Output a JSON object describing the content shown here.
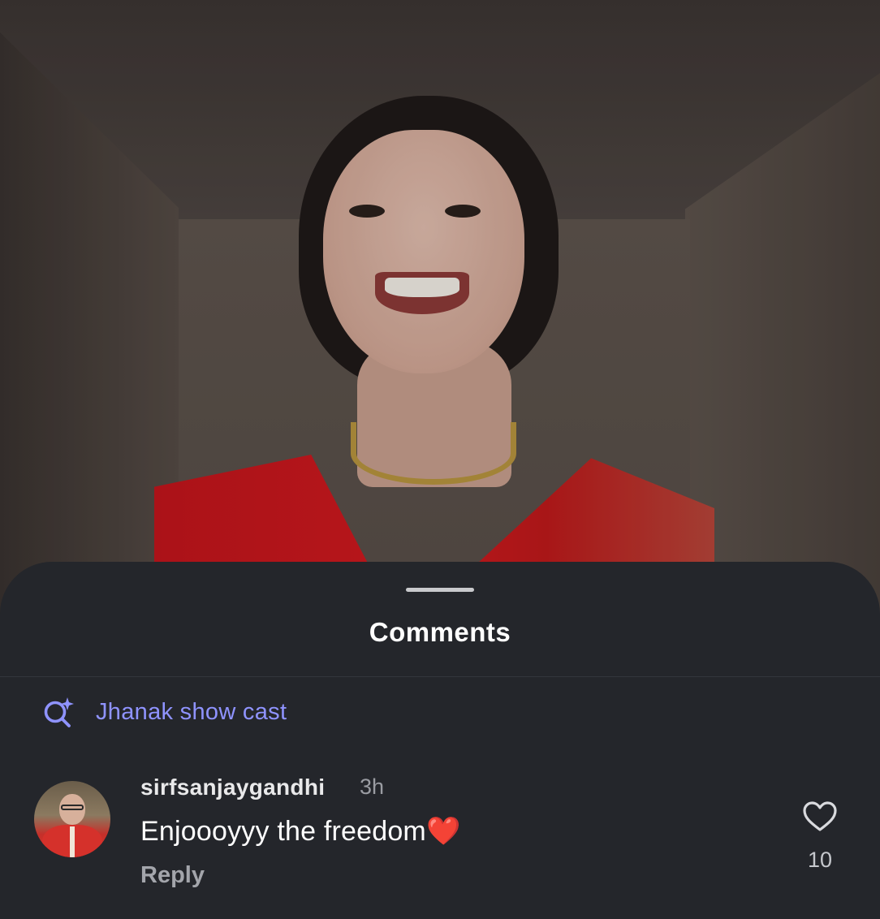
{
  "video": {
    "description_icon": "video-frame"
  },
  "comments_sheet": {
    "title": "Comments",
    "search_suggestion": {
      "icon": "sparkle-search-icon",
      "text": "Jhanak show cast"
    },
    "comments": [
      {
        "username": "sirfsanjaygandhi",
        "time": "3h",
        "text": "Enjoooyyy the freedom❤️",
        "reply_label": "Reply",
        "likes": "10",
        "like_icon": "heart-outline-icon"
      }
    ]
  },
  "colors": {
    "sheet_bg": "#24262b",
    "accent_search": "#8f93ff",
    "title": "#ffffff"
  }
}
